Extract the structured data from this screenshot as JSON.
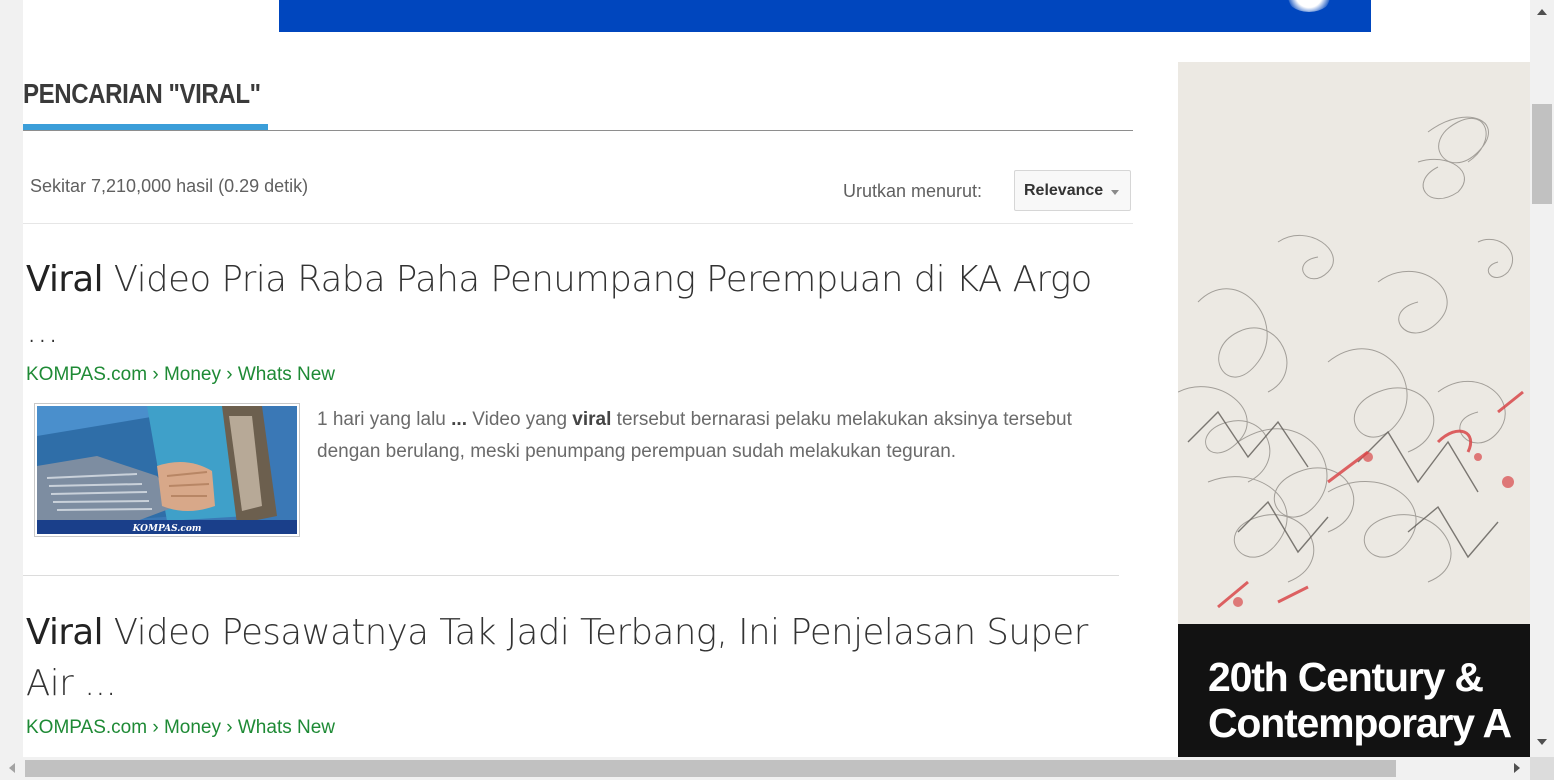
{
  "search": {
    "heading": "PENCARIAN \"VIRAL\"",
    "stats": "Sekitar 7,210,000 hasil (0.29 detik)",
    "sort_label": "Urutkan menurut:",
    "sort_selected": "Relevance"
  },
  "results": [
    {
      "title_bold": "Viral",
      "title_rest": " Video Pria Raba Paha Penumpang Perempuan di KA Argo ...",
      "breadcrumb": [
        "KOMPAS.com",
        "Money",
        "Whats New"
      ],
      "breadcrumb_sep": " › ",
      "thumbnail_label": "KOMPAS.com",
      "snippet": {
        "pre": "1 hari yang lalu ",
        "ellipsis": "...",
        "mid": " Video yang ",
        "bold": "viral",
        "post": " tersebut bernarasi pelaku melakukan aksinya tersebut dengan berulang, meski penumpang perempuan sudah melakukan teguran."
      }
    },
    {
      "title_bold": "Viral",
      "title_rest": " Video Pesawatnya Tak Jadi Terbang, Ini Penjelasan Super Air ...",
      "breadcrumb": [
        "KOMPAS.com",
        "Money",
        "Whats New"
      ],
      "breadcrumb_sep": " › "
    }
  ],
  "ad": {
    "caption_line1": "20th Century &",
    "caption_line2": "Contemporary A"
  },
  "colors": {
    "accent": "#3b9ed9",
    "url_green": "#1e8a35",
    "banner_blue": "#0046be"
  }
}
